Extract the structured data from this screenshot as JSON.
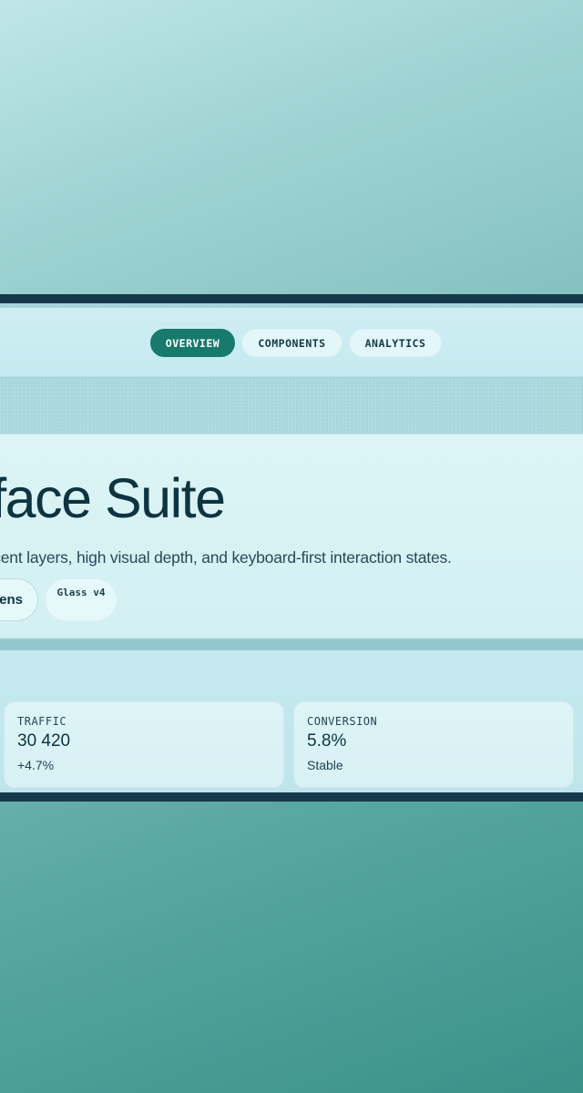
{
  "nav": {
    "tabs": [
      {
        "label": "OVERVIEW",
        "active": true
      },
      {
        "label": "COMPONENTS",
        "active": false
      },
      {
        "label": "ANALYTICS",
        "active": false
      }
    ]
  },
  "hero": {
    "title": "erface Suite",
    "subtitle": "lucent layers, high visual depth, and keyboard-first interaction states.",
    "chips": {
      "tokens_label": "ens",
      "version_label": "Glass v4"
    }
  },
  "stats": [
    {
      "label": "TRAFFIC",
      "value": "30 420",
      "note": "+4.7%"
    },
    {
      "label": "CONVERSION",
      "value": "5.8%",
      "note": "Stable"
    }
  ],
  "colors": {
    "accent": "#177a6c",
    "frame": "#15394a",
    "text_primary": "#0e3441"
  }
}
